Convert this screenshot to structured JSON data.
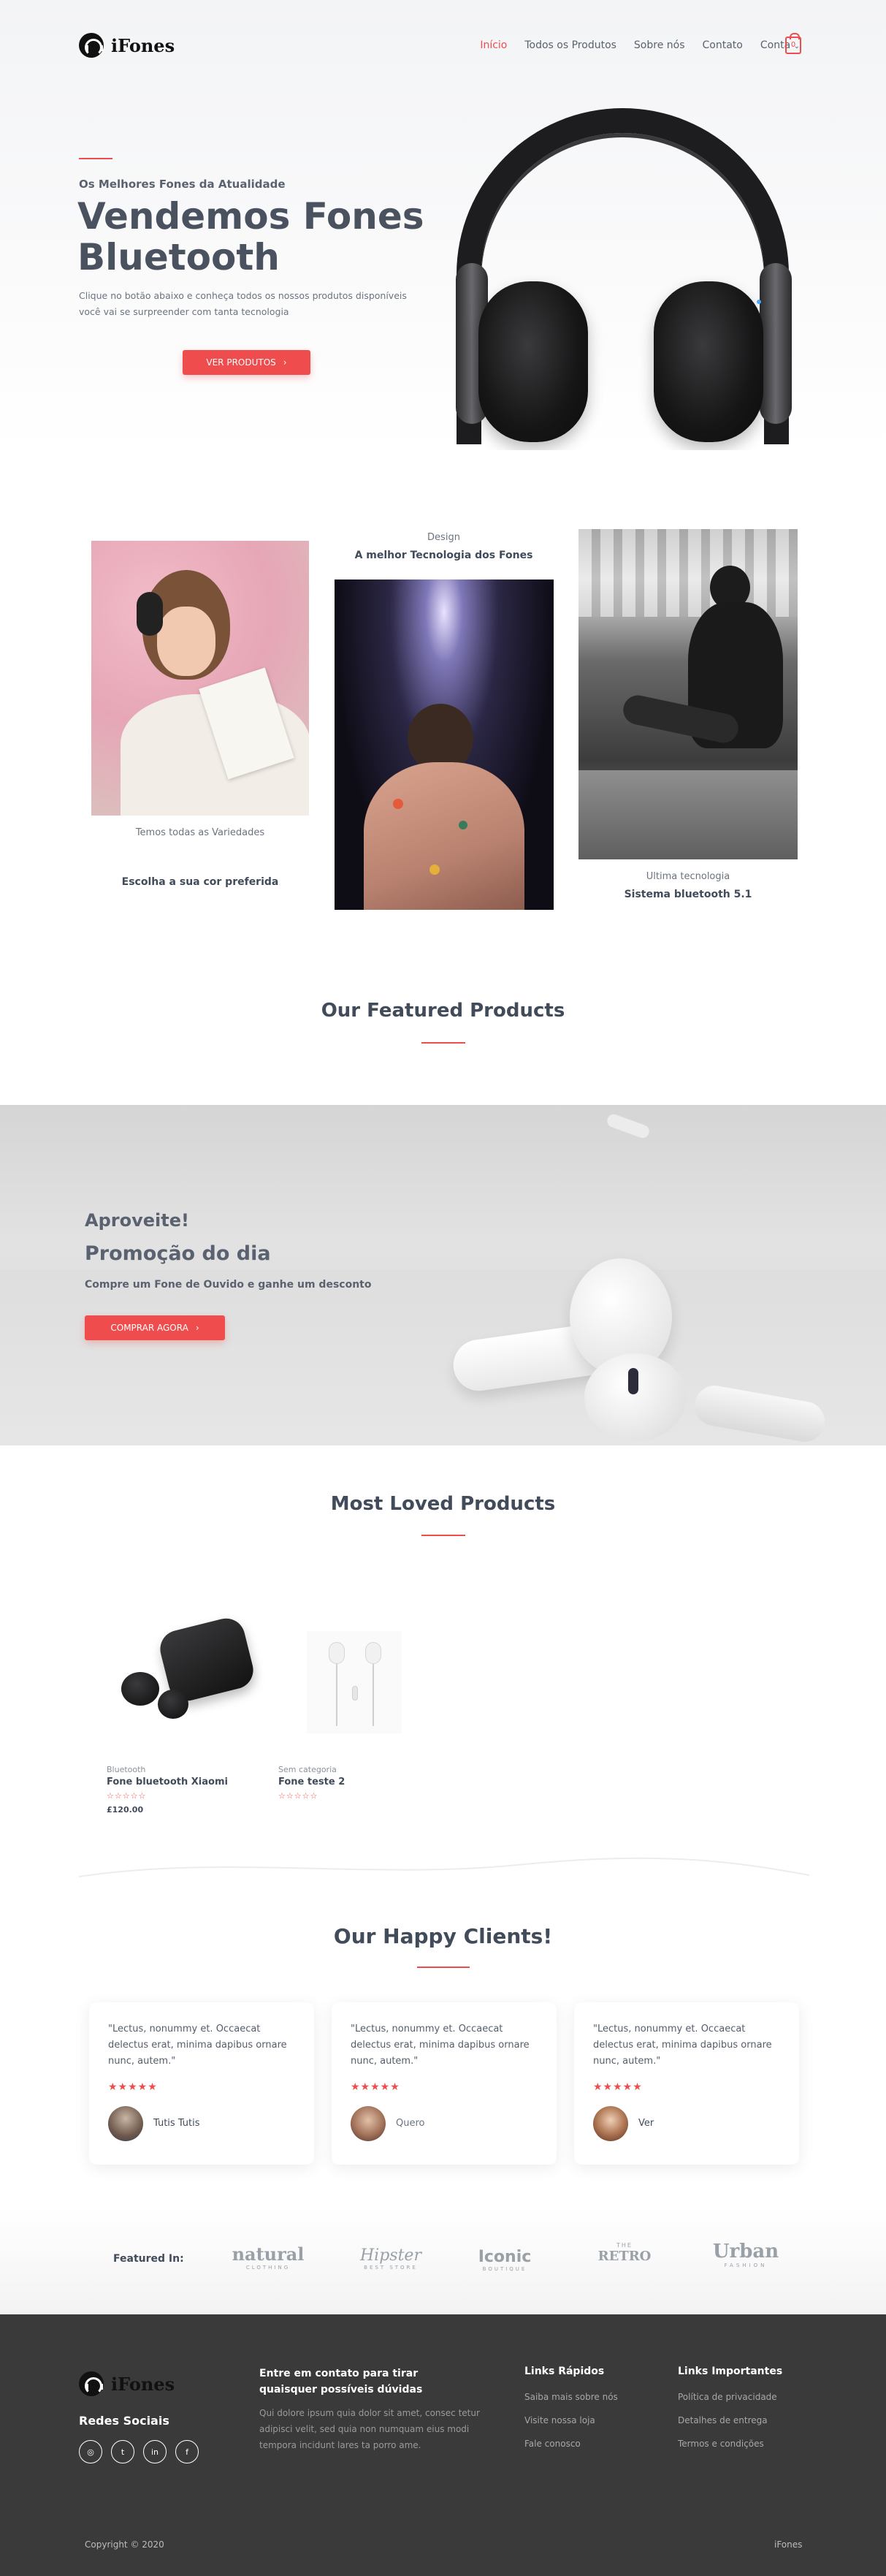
{
  "header": {
    "logo": "iFones",
    "nav": [
      "Início",
      "Todos os Produtos",
      "Sobre nós",
      "Contato",
      "Conta"
    ],
    "cart_count": "0"
  },
  "hero": {
    "eyebrow": "Os Melhores Fones da Atualidade",
    "title_line1": "Vendemos Fones",
    "title_line2": "Bluetooth",
    "text_line1": "Clique no botão abaixo e conheça todos os nossos produtos disponíveis",
    "text_line2": "você vai se surpreender com tanta tecnologia",
    "button": "VER PRODUTOS"
  },
  "features": {
    "left_caption": "Temos todas as Variedades",
    "left_title": "Escolha a sua cor preferida",
    "mid_caption": "Design",
    "mid_title": "A melhor Tecnologia dos Fones",
    "right_caption": "Ultima tecnologia",
    "right_title": "Sistema bluetooth 5.1"
  },
  "featured_heading": "Our Featured Products",
  "promo": {
    "line1": "Aproveite!",
    "line2": "Promoção do dia",
    "text": "Compre um Fone de Ouvido e ganhe um desconto",
    "button": "COMPRAR AGORA"
  },
  "loved_heading": "Most Loved Products",
  "products": [
    {
      "category": "Bluetooth",
      "name": "Fone bluetooth Xiaomi",
      "stars": "☆☆☆☆☆",
      "price": "£120.00"
    },
    {
      "category": "Sem categoria",
      "name": "Fone teste 2",
      "stars": "☆☆☆☆☆",
      "price": ""
    }
  ],
  "clients_heading": "Our Happy Clients!",
  "testimonials": [
    {
      "quote": "\"Lectus, nonummy et. Occaecat delectus erat, minima dapibus ornare nunc, autem.\"",
      "stars": "★★★★★",
      "name": "Tutis Tutis"
    },
    {
      "quote": "\"Lectus, nonummy et. Occaecat delectus erat, minima dapibus ornare nunc, autem.\"",
      "stars": "★★★★★",
      "name": "Quero"
    },
    {
      "quote": "\"Lectus, nonummy et. Occaecat delectus erat, minima dapibus ornare nunc, autem.\"",
      "stars": "★★★★★",
      "name": "Ver"
    }
  ],
  "featured_in": {
    "label": "Featured In:",
    "brands": [
      "natural",
      "Hipster",
      "Iconic",
      "RETRO",
      "Urban"
    ],
    "brand_subs": [
      "CLOTHING",
      "BEST STORE",
      "BOUTIQUE",
      "THE",
      "FASHION"
    ]
  },
  "footer": {
    "logo": "iFones",
    "social_heading": "Redes Sociais",
    "social_icons": [
      "instagram-icon",
      "twitter-icon",
      "linkedin-icon",
      "facebook-icon"
    ],
    "contact_title": "Entre em contato para tirar quaisquer possíveis dúvidas",
    "contact_text": "Qui dolore ipsum quia dolor sit amet, consec tetur adipisci velit, sed quia non numquam eius modi tempora incidunt lares ta porro ame.",
    "quick_heading": "Links Rápidos",
    "quick_links": [
      "Saiba mais sobre nós",
      "Visite nossa loja",
      "Fale conosco"
    ],
    "important_heading": "Links Importantes",
    "important_links": [
      "Política de privacidade",
      "Detalhes de entrega",
      "Termos e condições"
    ],
    "copyright": "Copyright © 2020",
    "brand_right": "iFones"
  },
  "colors": {
    "accent": "#ef4d4d",
    "heading": "#414b5a",
    "footer_bg": "#3a3a3a"
  }
}
